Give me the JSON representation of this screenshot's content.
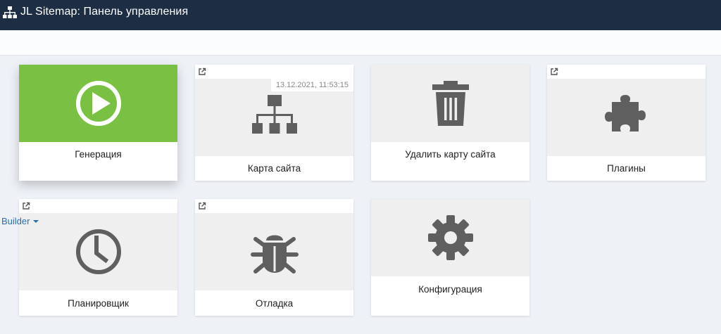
{
  "header": {
    "title": "JL Sitemap: Панель управления",
    "logo_icon": "sitemap-icon",
    "background": "#1c2d44"
  },
  "cards": {
    "generation": {
      "label": "Генерация",
      "icon": "play-circle-icon",
      "accent": "#7ac143"
    },
    "sitemap": {
      "label": "Карта сайта",
      "icon": "sitemap-icon",
      "timestamp": "13.12.2021, 11:53:15"
    },
    "delete": {
      "label": "Удалить карту сайта",
      "icon": "trash-icon"
    },
    "plugins": {
      "label": "Плагины",
      "icon": "puzzle-icon"
    },
    "scheduler": {
      "label": "Планировщик",
      "icon": "clock-icon"
    },
    "debug": {
      "label": "Отладка",
      "icon": "bug-icon"
    },
    "config": {
      "label": "Конфигурация",
      "icon": "gear-icon"
    }
  },
  "builder": {
    "label": "Builder"
  },
  "colors": {
    "icon_gray": "#5f5f5f",
    "tile_bg": "#efefef",
    "page_bg": "#eef2f7"
  }
}
